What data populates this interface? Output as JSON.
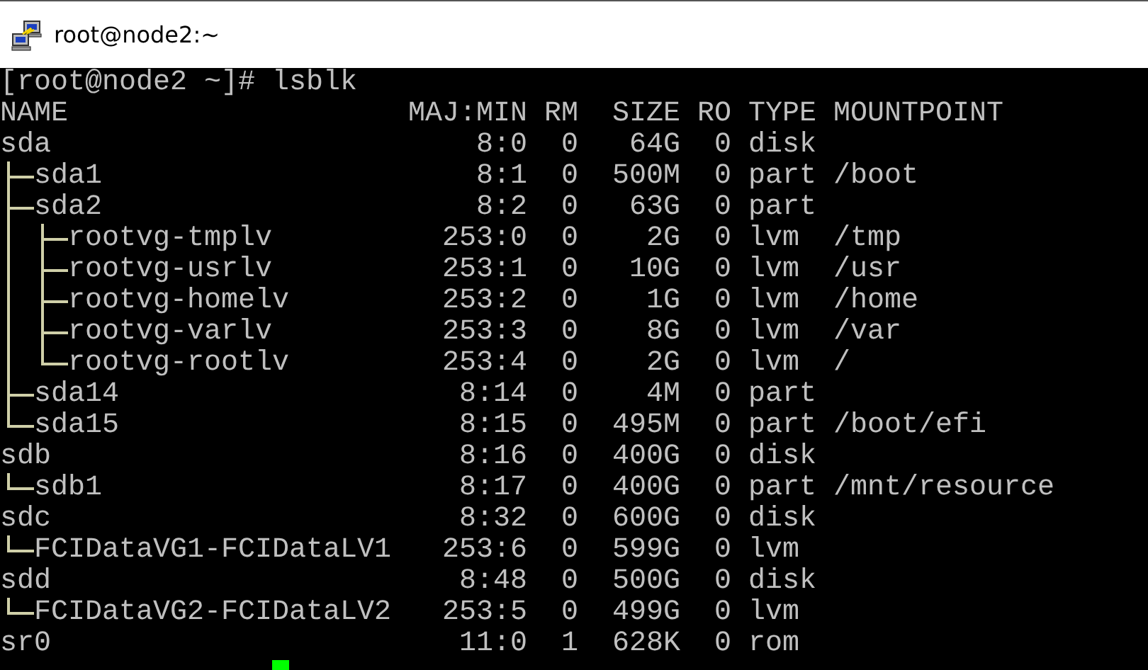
{
  "window": {
    "title": "root@node2:~"
  },
  "terminal": {
    "command_line": "[root@node2 ~]# lsblk",
    "columns": [
      "NAME",
      "MAJ:MIN",
      "RM",
      "SIZE",
      "RO",
      "TYPE",
      "MOUNTPOINT"
    ],
    "devices": [
      {
        "name": "sda",
        "maj_min": "8:0",
        "rm": "0",
        "size": "64G",
        "ro": "0",
        "type": "disk",
        "children": [
          {
            "name": "sda1",
            "maj_min": "8:1",
            "rm": "0",
            "size": "500M",
            "ro": "0",
            "type": "part",
            "mountpoint": "/boot"
          },
          {
            "name": "sda2",
            "maj_min": "8:2",
            "rm": "0",
            "size": "63G",
            "ro": "0",
            "type": "part",
            "children": [
              {
                "name": "rootvg-tmplv",
                "maj_min": "253:0",
                "rm": "0",
                "size": "2G",
                "ro": "0",
                "type": "lvm",
                "mountpoint": "/tmp"
              },
              {
                "name": "rootvg-usrlv",
                "maj_min": "253:1",
                "rm": "0",
                "size": "10G",
                "ro": "0",
                "type": "lvm",
                "mountpoint": "/usr"
              },
              {
                "name": "rootvg-homelv",
                "maj_min": "253:2",
                "rm": "0",
                "size": "1G",
                "ro": "0",
                "type": "lvm",
                "mountpoint": "/home"
              },
              {
                "name": "rootvg-varlv",
                "maj_min": "253:3",
                "rm": "0",
                "size": "8G",
                "ro": "0",
                "type": "lvm",
                "mountpoint": "/var"
              },
              {
                "name": "rootvg-rootlv",
                "maj_min": "253:4",
                "rm": "0",
                "size": "2G",
                "ro": "0",
                "type": "lvm",
                "mountpoint": "/"
              }
            ]
          },
          {
            "name": "sda14",
            "maj_min": "8:14",
            "rm": "0",
            "size": "4M",
            "ro": "0",
            "type": "part"
          },
          {
            "name": "sda15",
            "maj_min": "8:15",
            "rm": "0",
            "size": "495M",
            "ro": "0",
            "type": "part",
            "mountpoint": "/boot/efi"
          }
        ]
      },
      {
        "name": "sdb",
        "maj_min": "8:16",
        "rm": "0",
        "size": "400G",
        "ro": "0",
        "type": "disk",
        "children": [
          {
            "name": "sdb1",
            "maj_min": "8:17",
            "rm": "0",
            "size": "400G",
            "ro": "0",
            "type": "part",
            "mountpoint": "/mnt/resource"
          }
        ]
      },
      {
        "name": "sdc",
        "maj_min": "8:32",
        "rm": "0",
        "size": "600G",
        "ro": "0",
        "type": "disk",
        "children": [
          {
            "name": "FCIDataVG1-FCIDataLV1",
            "maj_min": "253:6",
            "rm": "0",
            "size": "599G",
            "ro": "0",
            "type": "lvm"
          }
        ]
      },
      {
        "name": "sdd",
        "maj_min": "8:48",
        "rm": "0",
        "size": "500G",
        "ro": "0",
        "type": "disk",
        "children": [
          {
            "name": "FCIDataVG2-FCIDataLV2",
            "maj_min": "253:5",
            "rm": "0",
            "size": "499G",
            "ro": "0",
            "type": "lvm"
          }
        ]
      },
      {
        "name": "sr0",
        "maj_min": "11:0",
        "rm": "1",
        "size": "628K",
        "ro": "0",
        "type": "rom"
      }
    ]
  }
}
